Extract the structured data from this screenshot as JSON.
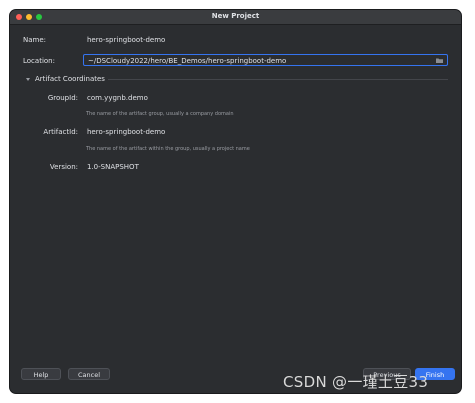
{
  "window": {
    "title": "New Project"
  },
  "form": {
    "name_label": "Name:",
    "name_value": "hero-springboot-demo",
    "location_label": "Location:",
    "location_value": "~/DSCloudy2022/hero/BE_Demos/hero-springboot-demo",
    "section_title": "Artifact Coordinates",
    "groupid_label": "GroupId:",
    "groupid_value": "com.yygnb.demo",
    "groupid_hint": "The name of the artifact group, usually a company domain",
    "artifactid_label": "ArtifactId:",
    "artifactid_value": "hero-springboot-demo",
    "artifactid_hint": "The name of the artifact within the group, usually a project name",
    "version_label": "Version:",
    "version_value": "1.0-SNAPSHOT"
  },
  "buttons": {
    "help": "Help",
    "cancel": "Cancel",
    "previous": "Previous",
    "finish": "Finish"
  },
  "icons": {
    "folder": "folder-icon",
    "expand": "chevron-down-icon"
  },
  "watermark": "CSDN @一瑾土豆33",
  "colors": {
    "accent": "#3574f0",
    "background": "#2b2d30",
    "close": "#ff5f57",
    "minimize": "#febc2e",
    "maximize": "#28c840"
  }
}
